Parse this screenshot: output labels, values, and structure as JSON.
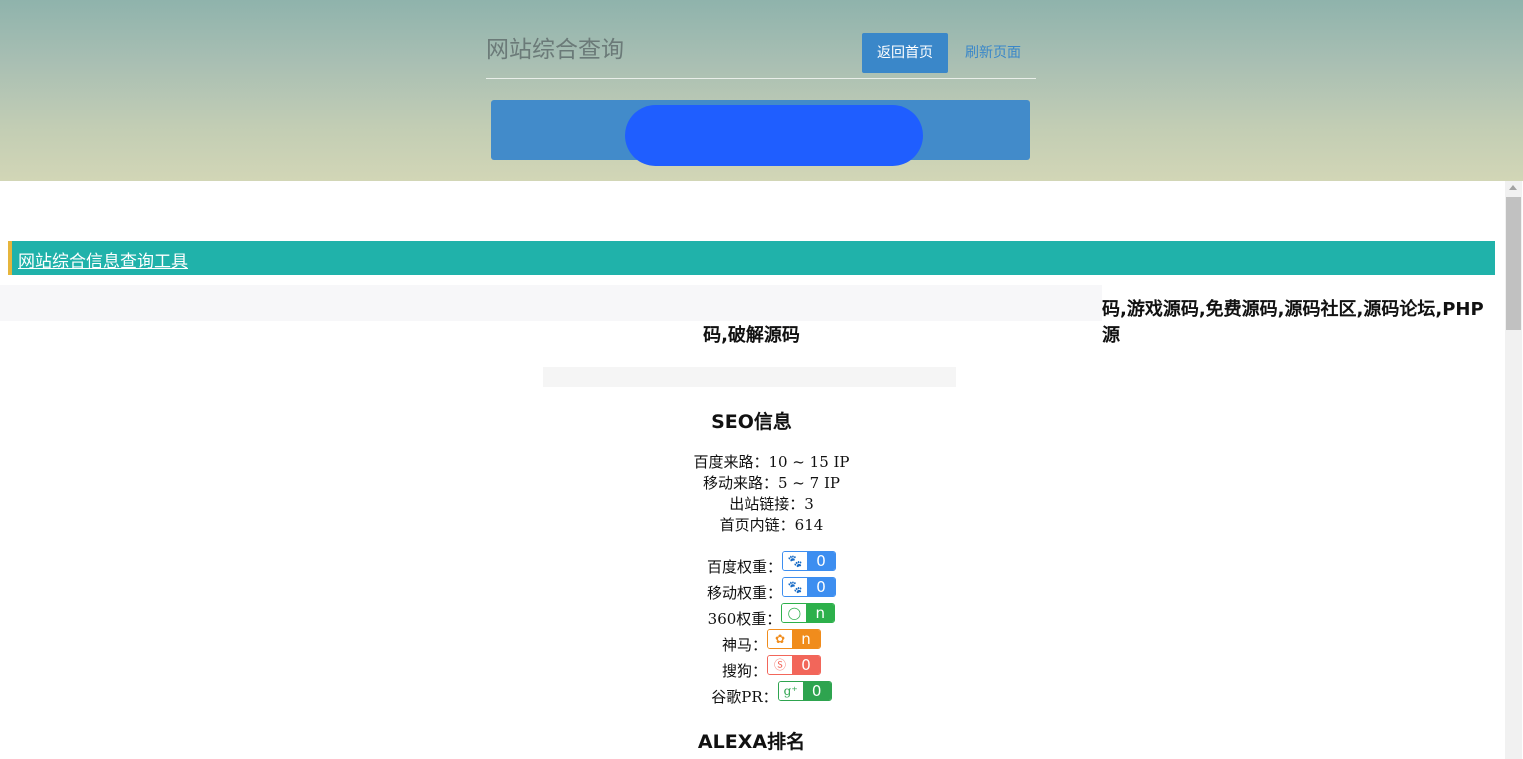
{
  "header": {
    "site_title": "网站综合查询",
    "home_button": "返回首页",
    "refresh_link": "刷新页面"
  },
  "tool_bar": {
    "link_text": "网站综合信息查询工具"
  },
  "keywords": {
    "line1": "码,游戏源码,免费源码,源码社区,源码论坛,PHP源",
    "line2": "码,破解源码"
  },
  "seo": {
    "title": "SEO信息",
    "lines": [
      "百度来路：10 ~ 15 IP",
      "移动来路：5 ~ 7 IP",
      "出站链接：3",
      "首页内链：614"
    ],
    "weights": [
      {
        "label": "百度权重：",
        "icon": "baidu-paw-icon",
        "glyph": "🐾",
        "value": "0",
        "color": "#3d8ef0"
      },
      {
        "label": "移动权重：",
        "icon": "baidu-mobile-paw-icon",
        "glyph": "🐾",
        "value": "0",
        "color": "#3d8ef0"
      },
      {
        "label": "360权重：",
        "icon": "360-icon",
        "glyph": "◯",
        "value": "n",
        "color": "#2db04b"
      },
      {
        "label": "神马：",
        "icon": "shenma-icon",
        "glyph": "✿",
        "value": "n",
        "color": "#f08c1c"
      },
      {
        "label": "搜狗：",
        "icon": "sogou-icon",
        "glyph": "Ⓢ",
        "value": "0",
        "color": "#f2665a"
      },
      {
        "label": "谷歌PR：",
        "icon": "google-plus-icon",
        "glyph": "g⁺",
        "value": "0",
        "color": "#2ea44f"
      }
    ]
  },
  "alexa": {
    "title": "ALEXA排名"
  }
}
